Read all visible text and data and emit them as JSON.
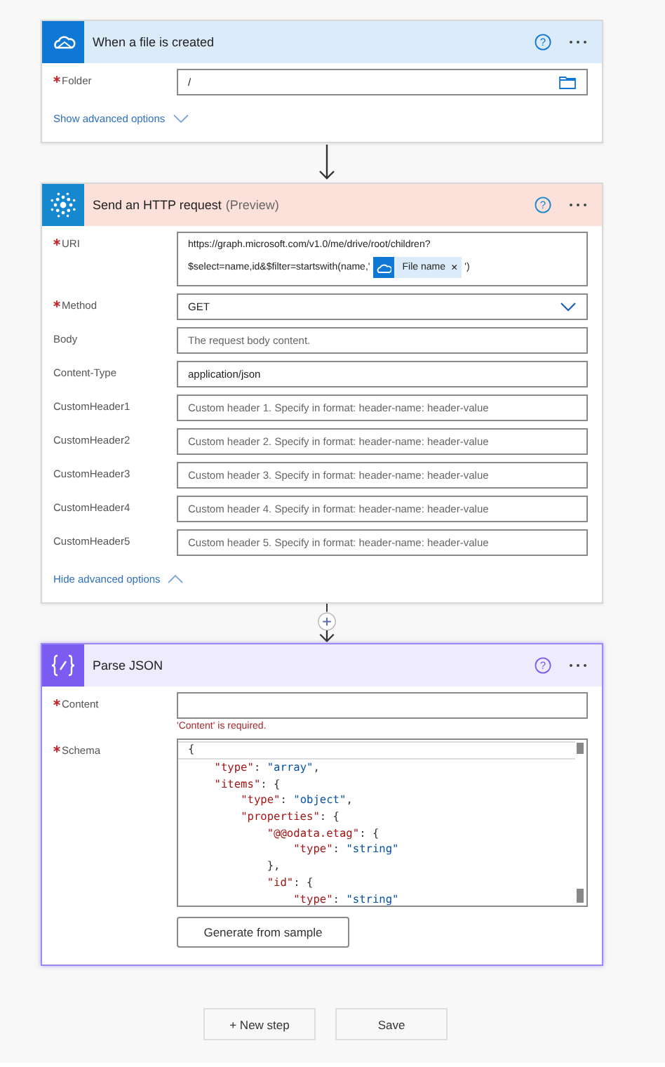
{
  "cards": [
    {
      "kind": "trigger",
      "title": "When a file is created",
      "selected": false,
      "help": "?",
      "fields": [
        {
          "kind": "picker",
          "label": "Folder",
          "required": true,
          "value": "/"
        }
      ],
      "advanced": {
        "label": "Show advanced options",
        "expanded": false
      }
    },
    {
      "kind": "http",
      "title": "Send an HTTP request",
      "subtitle": "(Preview)",
      "selected": false,
      "help": "?",
      "fields": [
        {
          "kind": "uri",
          "label": "URI",
          "required": true,
          "lines": [
            "https://graph.microsoft.com/v1.0/me/drive/root/children?",
            "$select=name,id&$filter=startswith(name,'"
          ],
          "token": {
            "label": "File name",
            "close": "×"
          },
          "after": "')"
        },
        {
          "kind": "dropdown",
          "label": "Method",
          "required": true,
          "value": "GET"
        },
        {
          "kind": "text",
          "label": "Body",
          "required": false,
          "placeholder": "The request body content."
        },
        {
          "kind": "text",
          "label": "Content-Type",
          "required": false,
          "value": "application/json"
        },
        {
          "kind": "text",
          "label": "CustomHeader1",
          "required": false,
          "placeholder": "Custom header 1. Specify in format: header-name: header-value"
        },
        {
          "kind": "text",
          "label": "CustomHeader2",
          "required": false,
          "placeholder": "Custom header 2. Specify in format: header-name: header-value"
        },
        {
          "kind": "text",
          "label": "CustomHeader3",
          "required": false,
          "placeholder": "Custom header 3. Specify in format: header-name: header-value"
        },
        {
          "kind": "text",
          "label": "CustomHeader4",
          "required": false,
          "placeholder": "Custom header 4. Specify in format: header-name: header-value"
        },
        {
          "kind": "text",
          "label": "CustomHeader5",
          "required": false,
          "placeholder": "Custom header 5. Specify in format: header-name: header-value"
        }
      ],
      "advanced": {
        "label": "Hide advanced options",
        "expanded": true
      }
    },
    {
      "kind": "parse",
      "title": "Parse JSON",
      "selected": true,
      "help": "?",
      "fields": [
        {
          "kind": "text",
          "label": "Content",
          "required": true,
          "error": "'Content' is required."
        },
        {
          "kind": "code",
          "label": "Schema",
          "required": true,
          "lines": [
            "{",
            "    \"type\": \"array\",",
            "    \"items\": {",
            "        \"type\": \"object\",",
            "        \"properties\": {",
            "            \"@@odata.etag\": {",
            "                \"type\": \"string\"",
            "            },",
            "            \"id\": {",
            "                \"type\": \"string\""
          ]
        },
        {
          "kind": "button",
          "label": "Generate from sample"
        }
      ]
    }
  ],
  "footer": {
    "buttons": [
      "+ New step",
      "Save"
    ]
  }
}
